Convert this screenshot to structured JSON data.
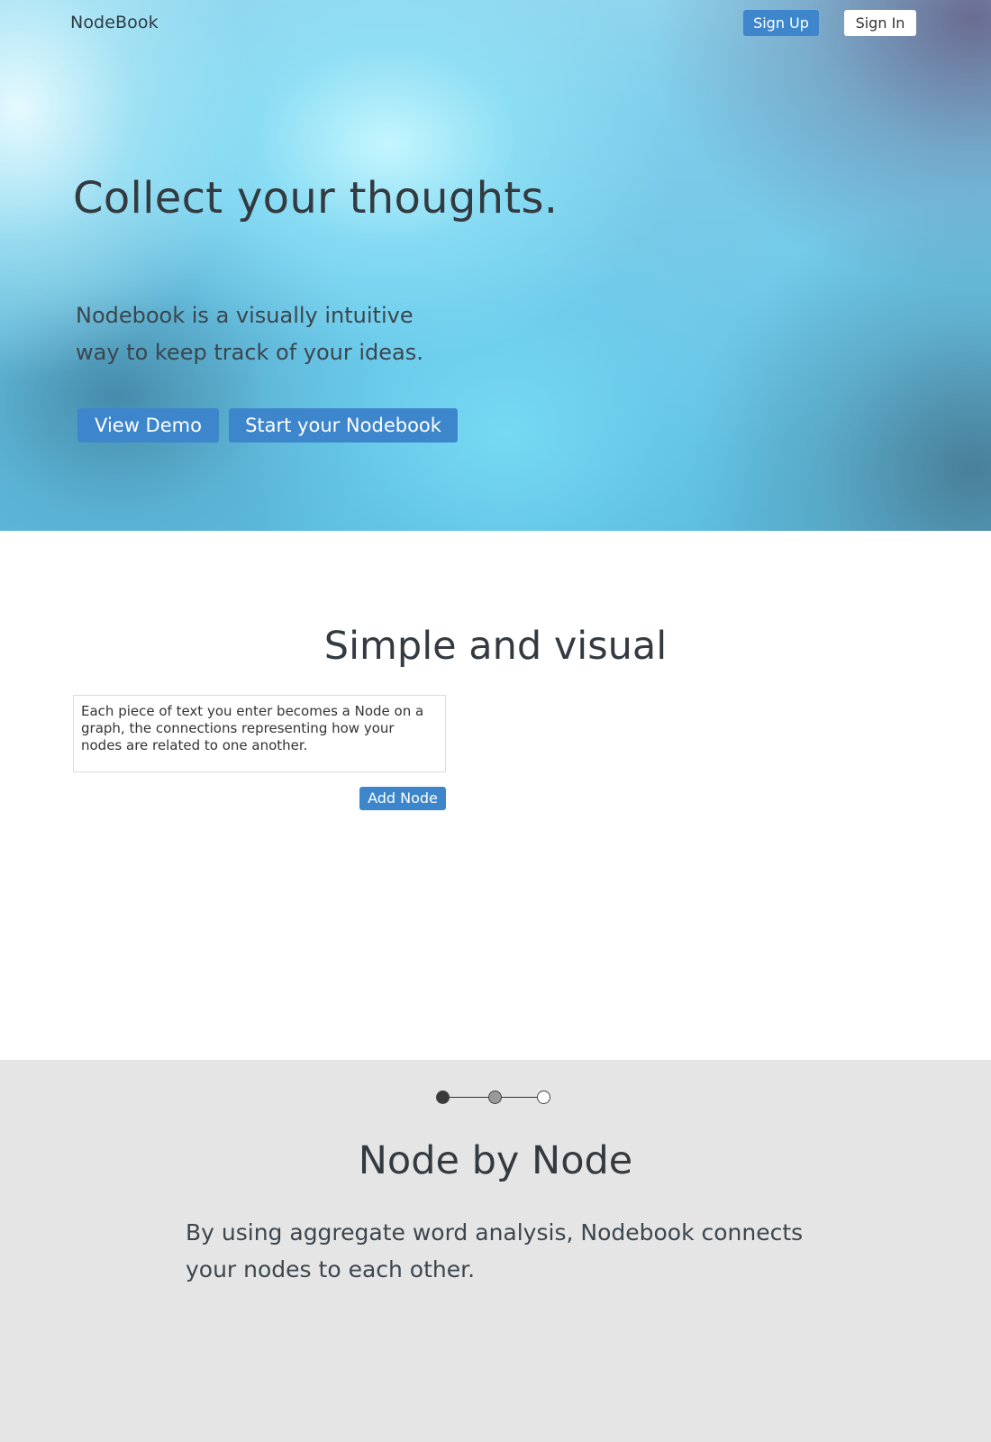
{
  "nav": {
    "brand": "NodeBook",
    "signup_label": "Sign Up",
    "signin_label": "Sign In"
  },
  "hero": {
    "title": "Collect your thoughts.",
    "subtitle": "Nodebook is a visually intuitive way to keep track of your ideas.",
    "demo_label": "View Demo",
    "start_label": "Start your Nodebook"
  },
  "simple_visual": {
    "title": "Simple and visual",
    "node_text": "Each piece of text you enter becomes a Node on a graph, the connections representing how your nodes are related to one another.",
    "add_label": "Add Node"
  },
  "node_by_node": {
    "steps": [
      {
        "state": "active",
        "color": "#3a3a3a"
      },
      {
        "state": "visited",
        "color": "#999999"
      },
      {
        "state": "pending",
        "color": "#ffffff"
      }
    ],
    "title": "Node by Node",
    "description": "By using aggregate word analysis, Nodebook connects your nodes to each other."
  },
  "colors": {
    "accent": "#3d86cc",
    "section_gray": "#e5e5e5"
  }
}
